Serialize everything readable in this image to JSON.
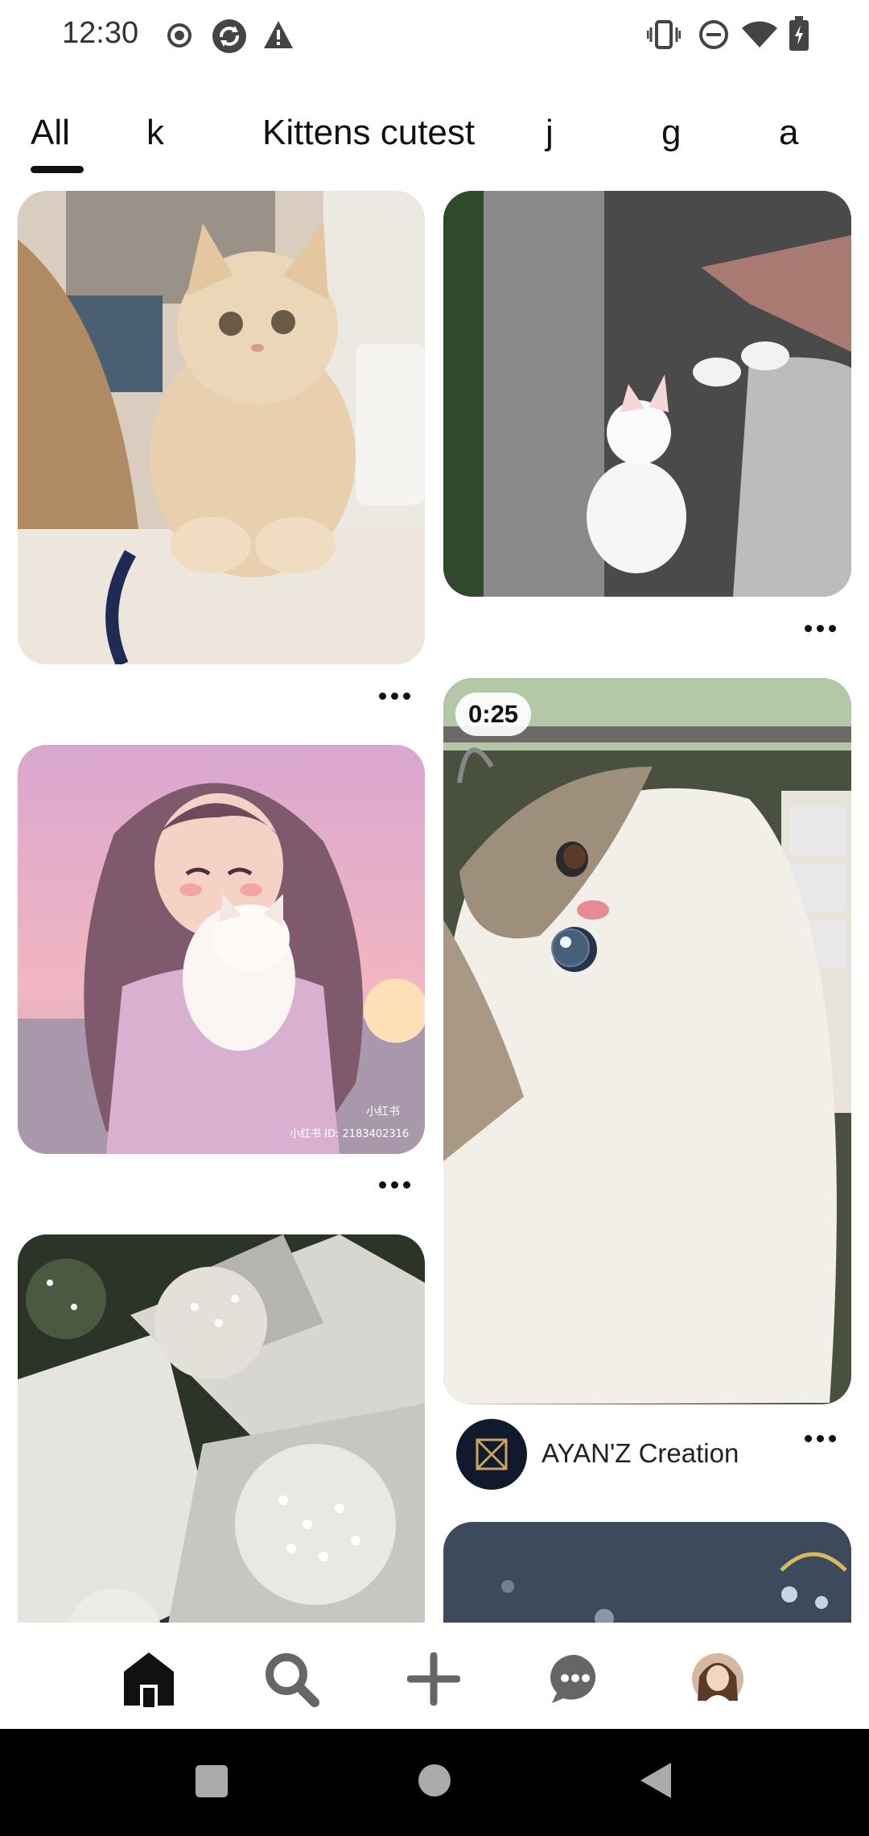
{
  "status_bar": {
    "time": "12:30",
    "left_icons": [
      "record-icon",
      "sync-icon",
      "alert-icon"
    ],
    "right_icons": [
      "vibrate-icon",
      "dnd-icon",
      "wifi-icon",
      "battery-icon"
    ]
  },
  "tabs": [
    {
      "label": "All",
      "selected": true
    },
    {
      "label": "k",
      "selected": false
    },
    {
      "label": "Kittens cutest",
      "selected": false
    },
    {
      "label": "j",
      "selected": false
    },
    {
      "label": "g",
      "selected": false
    },
    {
      "label": "a",
      "selected": false
    }
  ],
  "feed": {
    "pins": [
      {
        "name": "pin-cream-kitten",
        "image": "fluffy cream kitten photo"
      },
      {
        "name": "pin-white-kitten-sidewalk",
        "image": "white kitten on sidewalk photo"
      },
      {
        "name": "pin-anime-girl-cat",
        "image": "anime girl holding white cat illustration",
        "watermark": "小红书",
        "watermark_id": "小红书 ID: 2183402316"
      },
      {
        "name": "pin-fluffy-cat-video",
        "image": "fluffy white and grey cat video",
        "duration": "0:25"
      },
      {
        "name": "pin-flowers-bouquet",
        "image": "baby's breath flower bouquets photo"
      },
      {
        "name": "pin-dark-droplets",
        "image": "dark bokeh droplets image"
      }
    ],
    "creator": {
      "name": "AYAN'Z Creation"
    }
  },
  "bottom_nav": {
    "items": [
      "home-icon",
      "search-icon",
      "create-icon",
      "messages-icon",
      "profile-avatar"
    ],
    "active": "home-icon"
  },
  "system_nav": [
    "recents-icon",
    "home-circle-icon",
    "back-icon"
  ],
  "colors": {
    "accent": "#111111",
    "background": "#ffffff"
  }
}
